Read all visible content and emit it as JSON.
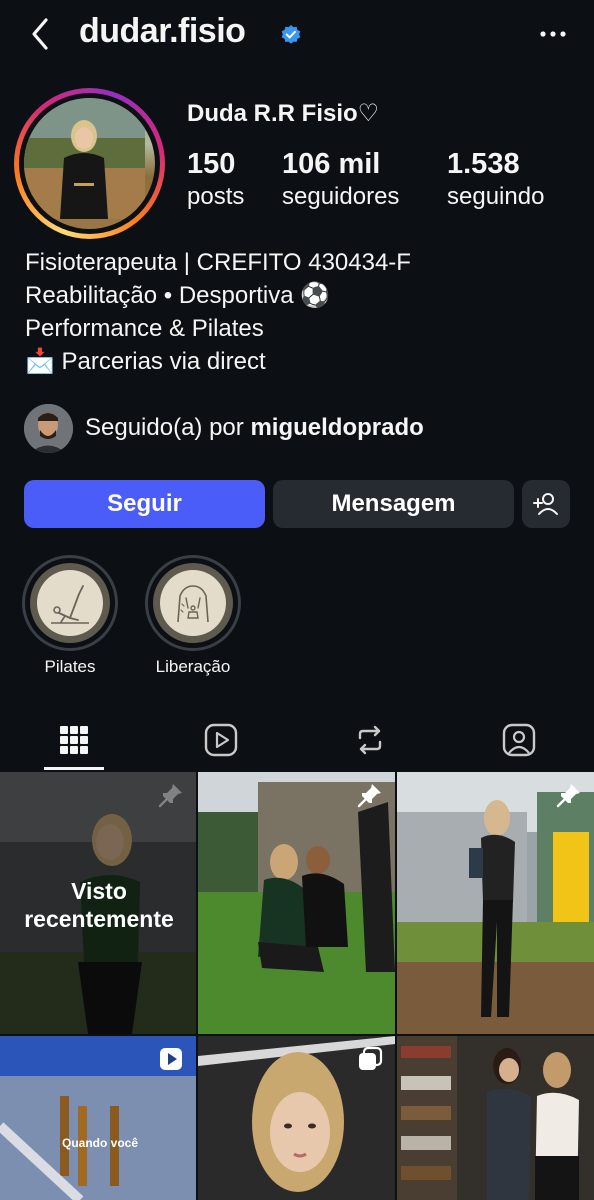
{
  "header": {
    "username": "dudar.fisio"
  },
  "profile": {
    "display_name": "Duda R.R Fisio♡",
    "stats": [
      {
        "value": "150",
        "label": "posts"
      },
      {
        "value": "106 mil",
        "label": "seguidores"
      },
      {
        "value": "1.538",
        "label": "seguindo"
      }
    ],
    "bio": [
      "Fisioterapeuta | CREFITO 430434-F",
      "Reabilitação • Desportiva ⚽",
      "Performance & Pilates",
      "📩 Parcerias via direct"
    ],
    "followed_by_prefix": "Seguido(a) por ",
    "followed_by_user": "migueldoprado"
  },
  "actions": {
    "follow_label": "Seguir",
    "message_label": "Mensagem"
  },
  "highlights": [
    {
      "label": "Pilates",
      "icon": "pilates-pose-icon"
    },
    {
      "label": "Liberação",
      "icon": "body-release-icon"
    }
  ],
  "tabs": [
    {
      "name": "grid-icon"
    },
    {
      "name": "reels-icon"
    },
    {
      "name": "repost-icon"
    },
    {
      "name": "tagged-icon"
    }
  ],
  "posts": {
    "recently_viewed_label": "Visto recentemente",
    "reel_caption": "Quando você"
  },
  "colors": {
    "accent": "#4a5df9",
    "background": "#0c0f14",
    "button_dark": "#262a31",
    "verified": "#3897f0"
  }
}
